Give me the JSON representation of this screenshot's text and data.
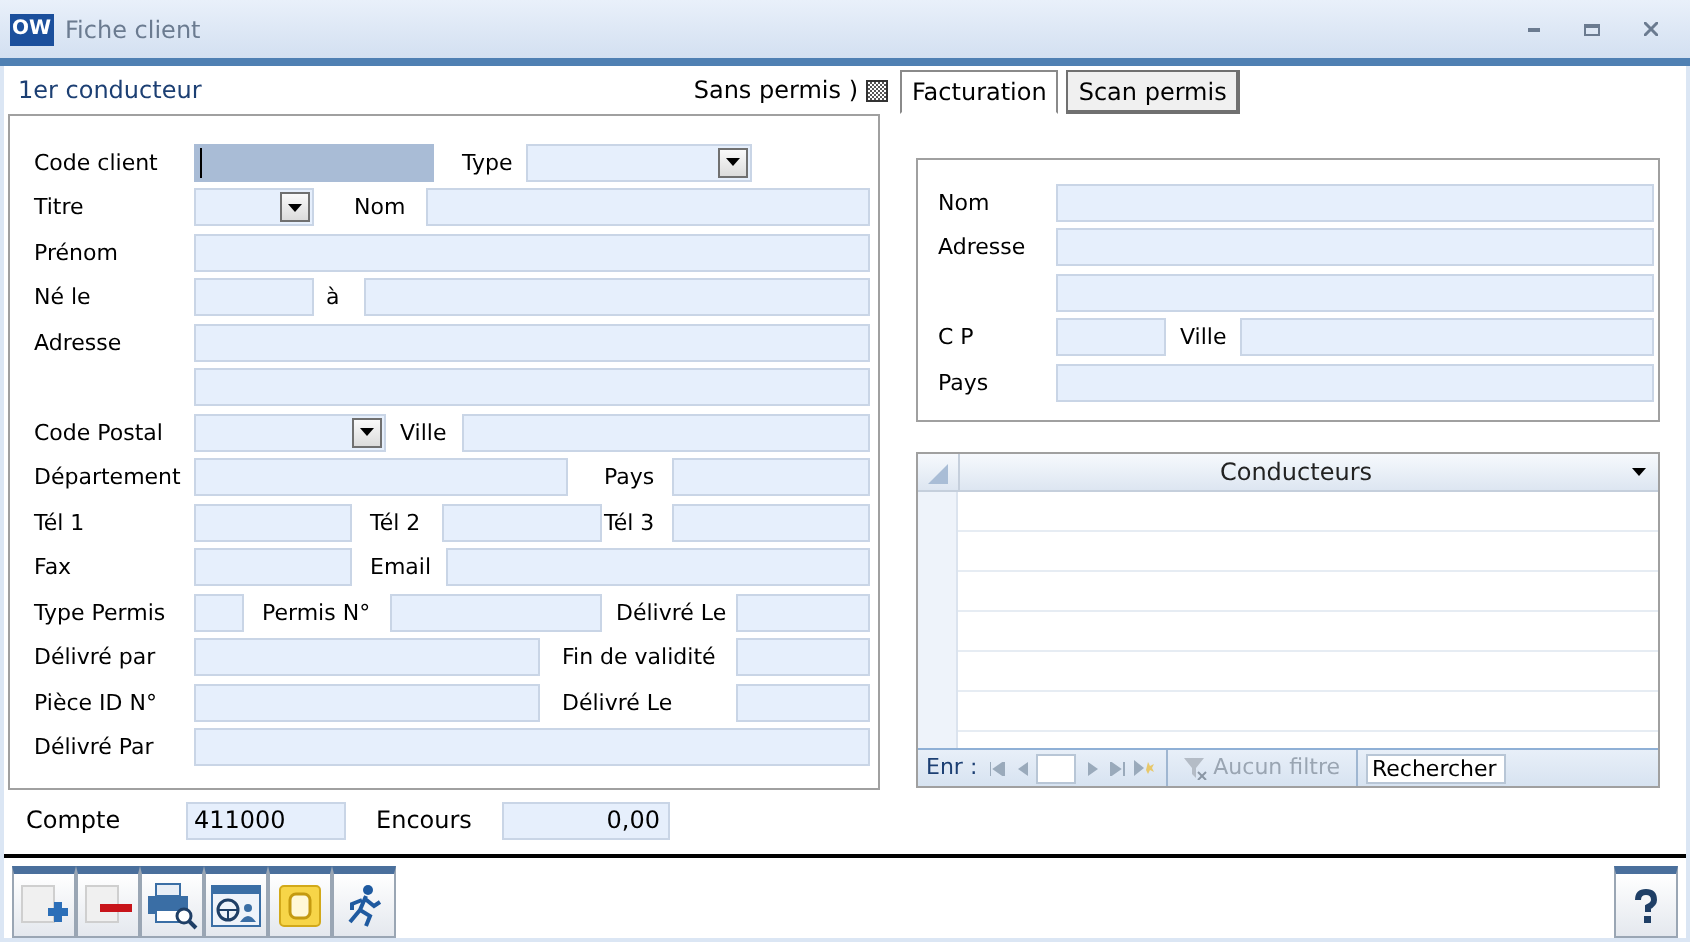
{
  "window": {
    "logo": "OW",
    "title": "Fiche client"
  },
  "driver": {
    "heading": "1er conducteur",
    "no_license": {
      "label": "Sans permis )",
      "checked": true
    },
    "rows": [
      [
        {
          "kind": "label",
          "text": "Code client"
        },
        {
          "kind": "field",
          "focused": true
        },
        {
          "kind": "label",
          "text": "Type"
        },
        {
          "kind": "dropdown",
          "focused": false
        }
      ],
      [
        {
          "kind": "label",
          "text": "Titre"
        },
        {
          "kind": "dropdown",
          "focused": false
        },
        {
          "kind": "label",
          "text": "Nom"
        },
        {
          "kind": "field",
          "focused": false
        }
      ],
      [
        {
          "kind": "label",
          "text": "Prénom"
        },
        {
          "kind": "field",
          "focused": false
        }
      ],
      [
        {
          "kind": "label",
          "text": "Né le"
        },
        {
          "kind": "field",
          "focused": false
        },
        {
          "kind": "label",
          "text": "à"
        },
        {
          "kind": "field",
          "focused": false
        }
      ],
      [
        {
          "kind": "label",
          "text": "Adresse"
        },
        {
          "kind": "field",
          "focused": false
        }
      ],
      [
        {
          "kind": "field",
          "focused": false
        }
      ],
      [
        {
          "kind": "label",
          "text": "Code Postal"
        },
        {
          "kind": "dropdown",
          "focused": false
        },
        {
          "kind": "label",
          "text": "Ville"
        },
        {
          "kind": "field",
          "focused": false
        }
      ],
      [
        {
          "kind": "label",
          "text": "Département"
        },
        {
          "kind": "field",
          "focused": false
        },
        {
          "kind": "label",
          "text": "Pays"
        },
        {
          "kind": "field",
          "focused": false
        }
      ],
      [
        {
          "kind": "label",
          "text": "Tél 1"
        },
        {
          "kind": "field",
          "focused": false
        },
        {
          "kind": "label",
          "text": "Tél 2"
        },
        {
          "kind": "field",
          "focused": false
        },
        {
          "kind": "label",
          "text": "Tél 3"
        },
        {
          "kind": "field",
          "focused": false
        }
      ],
      [
        {
          "kind": "label",
          "text": "Fax"
        },
        {
          "kind": "field",
          "focused": false
        },
        {
          "kind": "label",
          "text": "Email"
        },
        {
          "kind": "field",
          "focused": false
        }
      ],
      [
        {
          "kind": "label",
          "text": "Type Permis"
        },
        {
          "kind": "field",
          "focused": false
        },
        {
          "kind": "label",
          "text": "Permis N°"
        },
        {
          "kind": "field",
          "focused": false
        },
        {
          "kind": "label",
          "text": "Délivré Le"
        },
        {
          "kind": "field",
          "focused": false
        }
      ],
      [
        {
          "kind": "label",
          "text": "Délivré par"
        },
        {
          "kind": "field",
          "focused": false
        },
        {
          "kind": "label",
          "text": "Fin de validité"
        },
        {
          "kind": "field",
          "focused": false
        }
      ],
      [
        {
          "kind": "label",
          "text": "Pièce ID N°"
        },
        {
          "kind": "field",
          "focused": false
        },
        {
          "kind": "label",
          "text": "Délivré Le"
        },
        {
          "kind": "field",
          "focused": false
        }
      ],
      [
        {
          "kind": "label",
          "text": "Délivré Par"
        },
        {
          "kind": "field",
          "focused": false
        }
      ]
    ]
  },
  "account": {
    "label": "Compte",
    "value": "411000",
    "balance_label": "Encours",
    "balance": "0,00"
  },
  "tabs": [
    {
      "label": "Facturation",
      "selected": true
    },
    {
      "label": "Scan permis",
      "selected": false
    }
  ],
  "billing": {
    "rows": [
      [
        {
          "kind": "label",
          "text": "Nom"
        },
        {
          "kind": "field"
        }
      ],
      [
        {
          "kind": "label",
          "text": "Adresse"
        },
        {
          "kind": "field"
        }
      ],
      [
        {
          "kind": "field"
        }
      ],
      [
        {
          "kind": "label",
          "text": "C P"
        },
        {
          "kind": "field"
        },
        {
          "kind": "label",
          "text": "Ville"
        },
        {
          "kind": "field"
        }
      ],
      [
        {
          "kind": "label",
          "text": "Pays"
        },
        {
          "kind": "field"
        }
      ]
    ]
  },
  "drivers_grid": {
    "column": "Conducteurs",
    "nav_label": "Enr :",
    "filter": {
      "label": "Aucun filtre",
      "disabled": true
    },
    "search": "Rechercher"
  }
}
